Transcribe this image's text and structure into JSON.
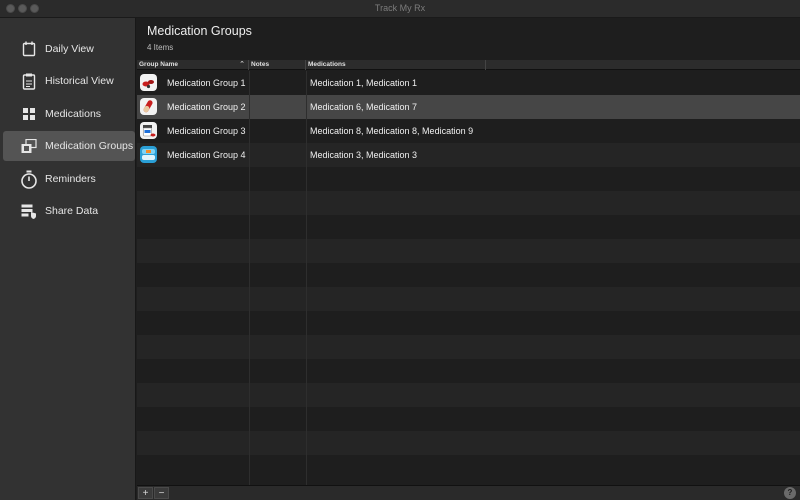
{
  "window": {
    "title": "Track My Rx"
  },
  "sidebar": {
    "items": [
      {
        "label": "Daily View",
        "icon": "calendar-icon",
        "active": false
      },
      {
        "label": "Historical View",
        "icon": "clipboard-icon",
        "active": false
      },
      {
        "label": "Medications",
        "icon": "grid-icon",
        "active": false
      },
      {
        "label": "Medication Groups",
        "icon": "medication-groups-icon",
        "active": true
      },
      {
        "label": "Reminders",
        "icon": "stopwatch-icon",
        "active": false
      },
      {
        "label": "Share Data",
        "icon": "share-data-icon",
        "active": false
      }
    ]
  },
  "header": {
    "title": "Medication Groups",
    "count": "4 Items"
  },
  "table": {
    "columns": [
      {
        "label": "Group Name",
        "sorted": "ascending"
      },
      {
        "label": "Notes"
      },
      {
        "label": "Medications"
      }
    ],
    "rows": [
      {
        "name": "Medication Group 1",
        "notes": "",
        "medications": "Medication 1, Medication 1",
        "icon": "pills-red-icon",
        "selected": false
      },
      {
        "name": "Medication Group 2",
        "notes": "",
        "medications": "Medication 6, Medication 7",
        "icon": "capsule-red-icon",
        "selected": true
      },
      {
        "name": "Medication Group 3",
        "notes": "",
        "medications": "Medication 8, Medication 8, Medication 9",
        "icon": "pill-bottle-icon",
        "selected": false
      },
      {
        "name": "Medication Group 4",
        "notes": "",
        "medications": "Medication 3, Medication 3",
        "icon": "inhaler-blue-icon",
        "selected": false
      }
    ]
  },
  "bottombar": {
    "add_label": "+",
    "remove_label": "−",
    "help_label": "?"
  },
  "colors": {
    "background": "#1e1e1e",
    "sidebar": "#323232",
    "selected_row": "#464646",
    "active_sidebar": "#545454"
  }
}
